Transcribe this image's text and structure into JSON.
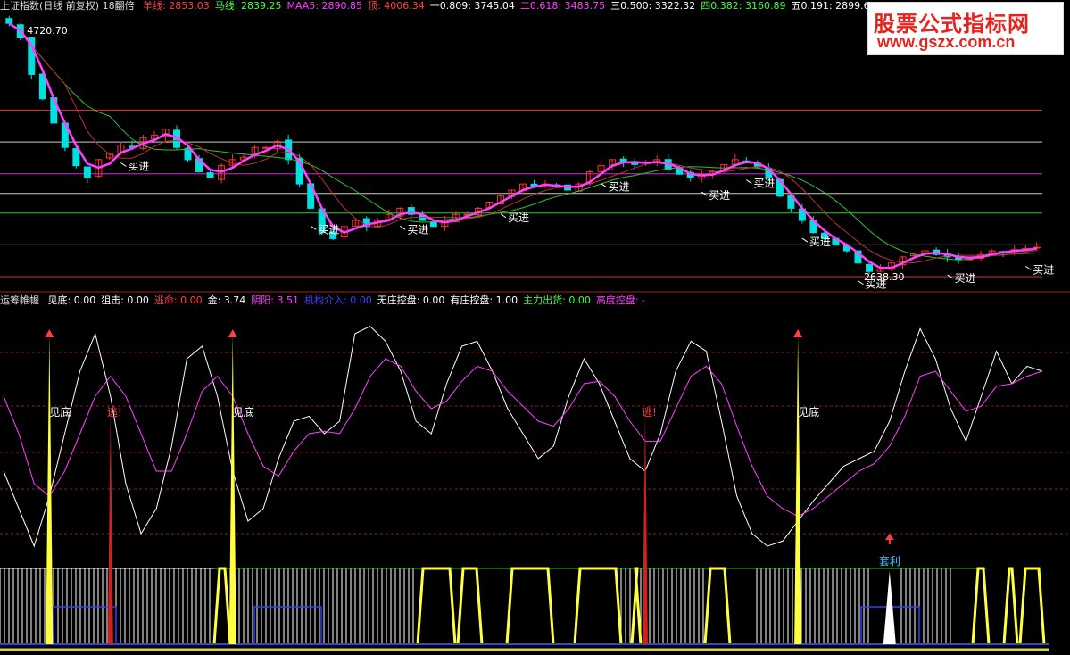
{
  "top_legend": {
    "title": "上证指数(日线 前复权) 18翻倍",
    "items": [
      {
        "label": "羊线:",
        "value": "2853.03",
        "color": "#ff4040"
      },
      {
        "label": "马线:",
        "value": "2839.25",
        "color": "#40ff40"
      },
      {
        "label": "MAA5:",
        "value": "2890.85",
        "color": "#ff40ff"
      },
      {
        "label": "顶:",
        "value": "4006.34",
        "color": "#ff4040"
      },
      {
        "label": "一0.809:",
        "value": "3745.04",
        "color": "#ffffff"
      },
      {
        "label": "二0.618:",
        "value": "3483.75",
        "color": "#ff40ff"
      },
      {
        "label": "三0.500:",
        "value": "3322.32",
        "color": "#ffffff"
      },
      {
        "label": "四0.382:",
        "value": "3160.89",
        "color": "#40ff40"
      },
      {
        "label": "五0.191:",
        "value": "2899.60",
        "color": "#ffffff"
      }
    ]
  },
  "mid_legend": {
    "title": "运筹帷幄",
    "items": [
      {
        "label": "见底:",
        "value": "0.00",
        "color": "#ffffff"
      },
      {
        "label": "狙击:",
        "value": "0.00",
        "color": "#ffffff"
      },
      {
        "label": "逃命:",
        "value": "0.00",
        "color": "#ff4040"
      },
      {
        "label": "金:",
        "value": "3.74",
        "color": "#ffffff"
      },
      {
        "label": "阴阳:",
        "value": "3.51",
        "color": "#ff40ff"
      },
      {
        "label": "机构介入:",
        "value": "0.00",
        "color": "#4040ff"
      },
      {
        "label": "无庄控盘:",
        "value": "0.00",
        "color": "#ffffff"
      },
      {
        "label": "有庄控盘:",
        "value": "1.00",
        "color": "#ffffff"
      },
      {
        "label": "主力出货:",
        "value": "0.00",
        "color": "#40ff40"
      },
      {
        "label": "高度控盘:",
        "value": "-",
        "color": "#ff40ff"
      }
    ]
  },
  "watermark": {
    "line1": "股票公式指标网",
    "line2": "www.gszx.com.cn"
  },
  "annotations": {
    "high_price": "4720.70",
    "low_price": "2638.30",
    "buy_label": "买进",
    "bottom_label": "见底",
    "escape_label": "逃!",
    "arbitrage_label": "套利"
  },
  "colors": {
    "up": "#ff3030",
    "down": "#00e0e0",
    "yellow": "#ffff40",
    "magenta": "#ff40ff",
    "green": "#30c030",
    "darkred": "#c03030",
    "blue": "#3040ff"
  },
  "chart_data": [
    {
      "type": "candlestick",
      "title": "上证指数(日线 前复权)",
      "ylim": [
        2550,
        4780
      ],
      "horizontal_levels": [
        {
          "name": "顶",
          "value": 4006.34,
          "color": "#ff4040"
        },
        {
          "name": "一0.809",
          "value": 3745.04,
          "color": "#ffffff"
        },
        {
          "name": "二0.618",
          "value": 3483.75,
          "color": "#ff40ff"
        },
        {
          "name": "三0.500",
          "value": 3322.32,
          "color": "#ffffff"
        },
        {
          "name": "四0.382",
          "value": 3160.89,
          "color": "#40ff40"
        },
        {
          "name": "五0.191",
          "value": 2899.6,
          "color": "#ffffff"
        },
        {
          "name": "底",
          "value": 2638.3,
          "color": "#ff4040"
        }
      ],
      "price_path": [
        4720,
        4600,
        4300,
        4100,
        3900,
        3700,
        3550,
        3450,
        3600,
        3650,
        3720,
        3700,
        3780,
        3800,
        3850,
        3700,
        3600,
        3500,
        3450,
        3550,
        3600,
        3620,
        3700,
        3700,
        3750,
        3600,
        3400,
        3200,
        3000,
        2950,
        3050,
        3100,
        3050,
        3100,
        3150,
        3200,
        3150,
        3100,
        3050,
        3100,
        3150,
        3150,
        3200,
        3250,
        3300,
        3350,
        3400,
        3380,
        3400,
        3380,
        3350,
        3400,
        3500,
        3550,
        3600,
        3580,
        3560,
        3580,
        3600,
        3520,
        3480,
        3450,
        3480,
        3500,
        3560,
        3600,
        3580,
        3540,
        3450,
        3300,
        3200,
        3100,
        3000,
        2950,
        2900,
        2850,
        2750,
        2680,
        2700,
        2750,
        2800,
        2830,
        2850,
        2820,
        2800,
        2780,
        2800,
        2820,
        2850,
        2840,
        2860,
        2870,
        2880
      ],
      "buy_signals_index": [
        10,
        27,
        35,
        44,
        53,
        62,
        66,
        71,
        76,
        84,
        91
      ]
    },
    {
      "type": "line",
      "title": "运筹帷幄",
      "series": [
        {
          "name": "金",
          "color": "#ffffff",
          "values": [
            40,
            25,
            10,
            30,
            55,
            80,
            95,
            70,
            35,
            15,
            25,
            50,
            85,
            90,
            70,
            40,
            20,
            25,
            45,
            60,
            62,
            55,
            60,
            95,
            98,
            92,
            80,
            60,
            55,
            75,
            90,
            92,
            80,
            65,
            55,
            45,
            50,
            70,
            85,
            75,
            60,
            45,
            40,
            55,
            80,
            92,
            88,
            60,
            30,
            15,
            10,
            12,
            20,
            28,
            35,
            42,
            45,
            48,
            60,
            80,
            97,
            85,
            65,
            52,
            70,
            88,
            75,
            82,
            80
          ]
        },
        {
          "name": "阴阳",
          "color": "#ff40ff",
          "values": [
            70,
            55,
            35,
            30,
            40,
            55,
            70,
            78,
            70,
            55,
            40,
            40,
            55,
            72,
            78,
            70,
            55,
            42,
            38,
            48,
            55,
            56,
            55,
            65,
            78,
            85,
            82,
            72,
            65,
            68,
            76,
            82,
            80,
            72,
            66,
            60,
            58,
            65,
            75,
            76,
            70,
            60,
            52,
            52,
            65,
            78,
            82,
            75,
            58,
            42,
            30,
            25,
            22,
            25,
            30,
            35,
            40,
            43,
            50,
            62,
            78,
            80,
            72,
            64,
            66,
            74,
            75,
            78,
            80
          ]
        }
      ],
      "signals": [
        {
          "name": "见底",
          "index": 3
        },
        {
          "name": "逃!",
          "index": 7
        },
        {
          "name": "见底",
          "index": 15
        },
        {
          "name": "逃!",
          "index": 42
        },
        {
          "name": "见底",
          "index": 52
        },
        {
          "name": "套利",
          "index": 58
        }
      ]
    }
  ]
}
